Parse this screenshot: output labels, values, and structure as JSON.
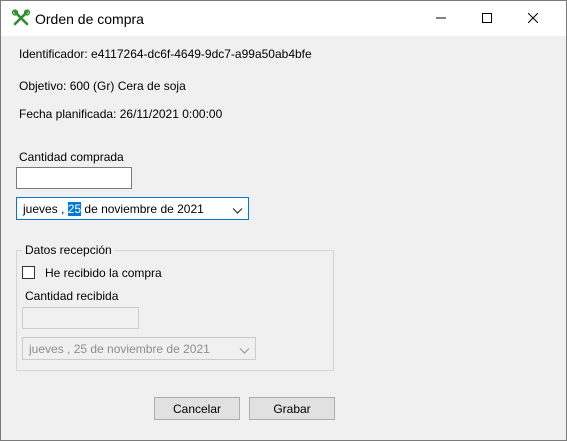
{
  "window": {
    "title": "Orden de compra"
  },
  "info": {
    "identificador": "Identificador: e4117264-dc6f-4649-9dc7-a99a50ab4bfe",
    "objetivo": "Objetivo:  600 (Gr) Cera de soja",
    "fecha": "Fecha planificada: 26/11/2021 0:00:00"
  },
  "compra": {
    "cantidad_label": "Cantidad comprada",
    "cantidad_value": "",
    "date_prefix": "jueves   , ",
    "date_day": "25",
    "date_suffix": " de noviembre de 2021"
  },
  "recepcion": {
    "group_label": "Datos recepción",
    "checkbox_label": "He recibido la compra",
    "checkbox_checked": false,
    "cantidad_label": "Cantidad recibida",
    "cantidad_value": "",
    "date_text": "jueves   , 25 de noviembre de 2021"
  },
  "buttons": {
    "cancel": "Cancelar",
    "save": "Grabar"
  },
  "icons": {
    "app": "tools-icon",
    "minimize": "minimize-icon",
    "maximize": "maximize-icon",
    "close": "close-icon",
    "dropdown": "chevron-down-icon"
  }
}
